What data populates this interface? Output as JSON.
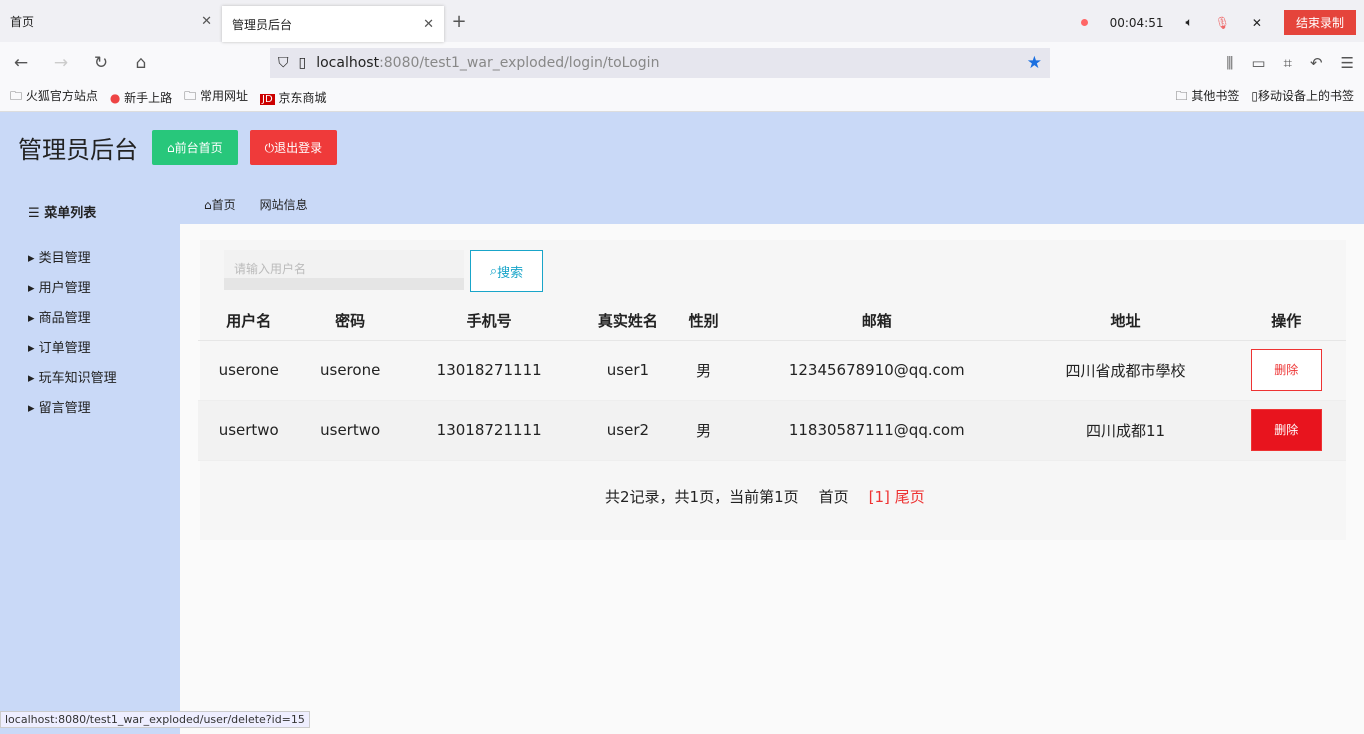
{
  "browser": {
    "tabs": [
      {
        "label": "首页"
      },
      {
        "label": "管理员后台"
      }
    ],
    "url_host": "localhost",
    "url_rest": ":8080/test1_war_exploded/login/toLogin",
    "recording": {
      "time": "00:04:51",
      "end_label": "结束录制"
    },
    "bookmarks": [
      "火狐官方站点",
      "新手上路",
      "常用网址",
      "京东商城"
    ],
    "bookmarks_right": [
      "其他书签",
      "移动设备上的书签"
    ],
    "status_url": "localhost:8080/test1_war_exploded/user/delete?id=15"
  },
  "header": {
    "title": "管理员后台",
    "front_label": "前台首页",
    "logout_label": "退出登录"
  },
  "sidebar": {
    "title": "菜单列表",
    "items": [
      "类目管理",
      "用户管理",
      "商品管理",
      "订单管理",
      "玩车知识管理",
      "留言管理"
    ]
  },
  "breadcrumb": {
    "home": "首页",
    "site": "网站信息"
  },
  "search": {
    "placeholder": "请输入用户名",
    "button": "搜索"
  },
  "table": {
    "headers": [
      "用户名",
      "密码",
      "手机号",
      "真实姓名",
      "性别",
      "邮箱",
      "地址",
      "操作"
    ],
    "rows": [
      [
        "userone",
        "userone",
        "13018271111",
        "user1",
        "男",
        "12345678910@qq.com",
        "四川省成都市學校",
        "删除"
      ],
      [
        "usertwo",
        "usertwo",
        "13018721111",
        "user2",
        "男",
        "11830587111@qq.com",
        "四川成都11",
        "删除"
      ]
    ]
  },
  "pager": {
    "info": "共2记录，共1页，当前第1页",
    "first": "首页",
    "current": "[1]",
    "last": "尾页"
  }
}
